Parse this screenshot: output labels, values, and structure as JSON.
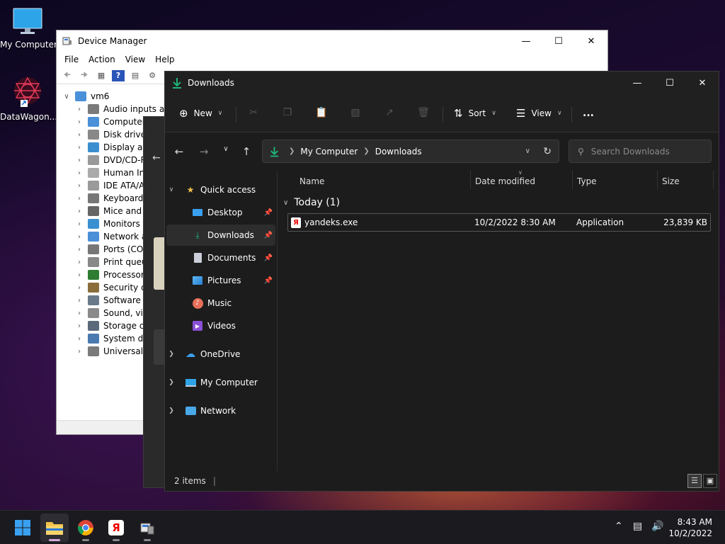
{
  "desktop": {
    "icons": [
      {
        "label": "My Computer"
      },
      {
        "label": "DataWagon..."
      }
    ]
  },
  "device_manager": {
    "title": "Device Manager",
    "menu": [
      "File",
      "Action",
      "View",
      "Help"
    ],
    "root": "vm6",
    "items": [
      "Audio inputs and",
      "Computer",
      "Disk drives",
      "Display ada",
      "DVD/CD-RC",
      "Human Int",
      "IDE ATA/AT",
      "Keyboards",
      "Mice and o",
      "Monitors",
      "Network ac",
      "Ports (COM",
      "Print queue",
      "Processors",
      "Security de",
      "Software de",
      "Sound, vide",
      "Storage co",
      "System dev",
      "Universal S"
    ]
  },
  "explorer": {
    "title": "Downloads",
    "toolbar": {
      "new": "New",
      "sort": "Sort",
      "view": "View",
      "more": "..."
    },
    "breadcrumb": [
      "My Computer",
      "Downloads"
    ],
    "search_placeholder": "Search Downloads",
    "sidebar": {
      "quick_access": "Quick access",
      "pinned": [
        "Desktop",
        "Downloads",
        "Documents",
        "Pictures"
      ],
      "others": [
        "Music",
        "Videos"
      ],
      "onedrive": "OneDrive",
      "my_computer": "My Computer",
      "network": "Network"
    },
    "columns": {
      "name": "Name",
      "date": "Date modified",
      "type": "Type",
      "size": "Size"
    },
    "group": "Today (1)",
    "files": [
      {
        "name": "yandeks.exe",
        "date": "10/2/2022 8:30 AM",
        "type": "Application",
        "size": "23,839 KB"
      }
    ],
    "status": "2 items"
  },
  "taskbar": {
    "time": "8:43 AM",
    "date": "10/2/2022"
  },
  "colors": {
    "accent_green": "#1fb57a",
    "folder_yellow": "#f2c14b",
    "start_blue": "#3aa0f0"
  }
}
